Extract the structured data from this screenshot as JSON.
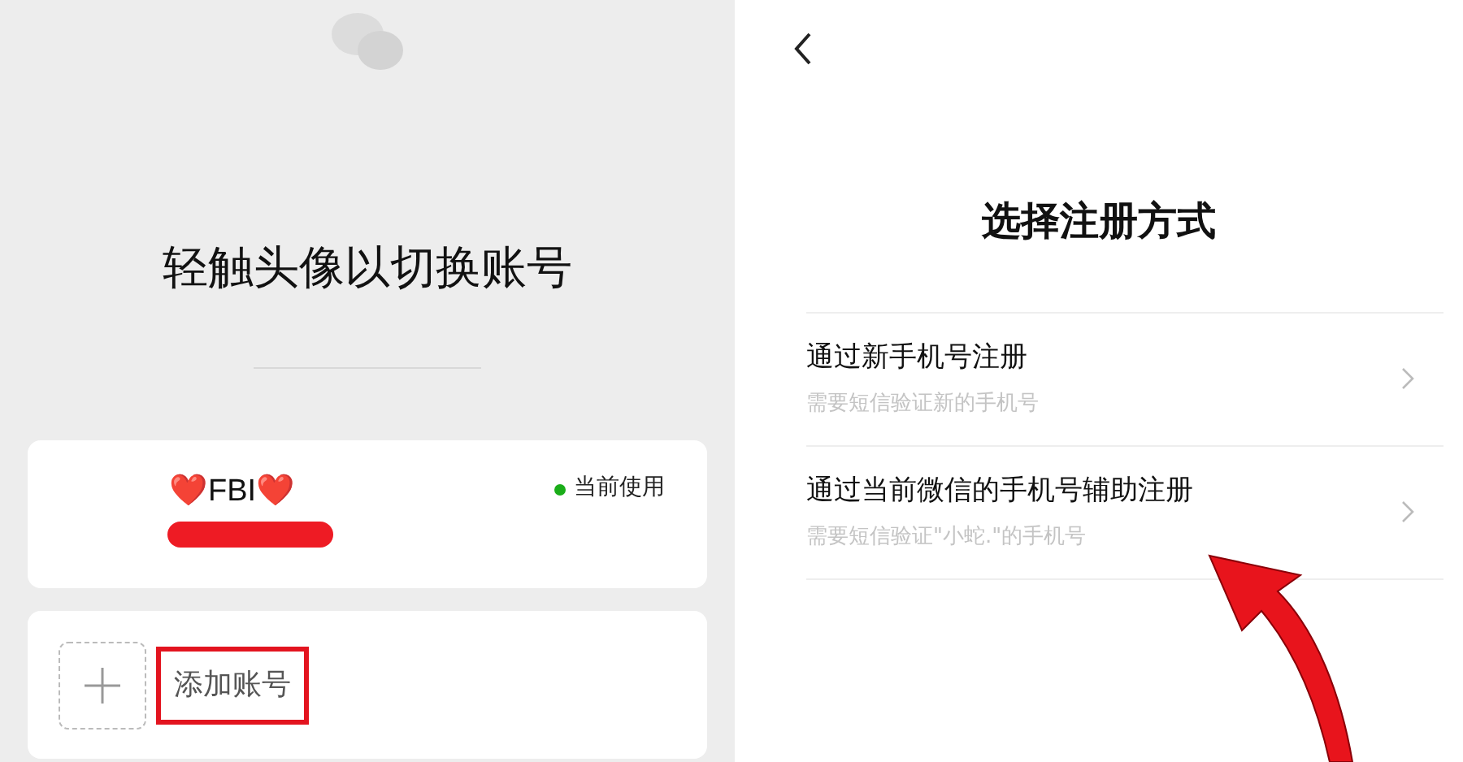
{
  "switch_account": {
    "title": "轻触头像以切换账号",
    "accounts": [
      {
        "name": "❤️FBI❤️",
        "status": "当前使用",
        "current": true,
        "redacted": true
      }
    ],
    "add_account": {
      "label": "添加账号",
      "highlighted": true
    }
  },
  "register": {
    "title": "选择注册方式",
    "options": [
      {
        "title": "通过新手机号注册",
        "subtitle": "需要短信验证新的手机号"
      },
      {
        "title": "通过当前微信的手机号辅助注册",
        "subtitle": "需要短信验证\"小蛇.\"的手机号"
      }
    ]
  }
}
